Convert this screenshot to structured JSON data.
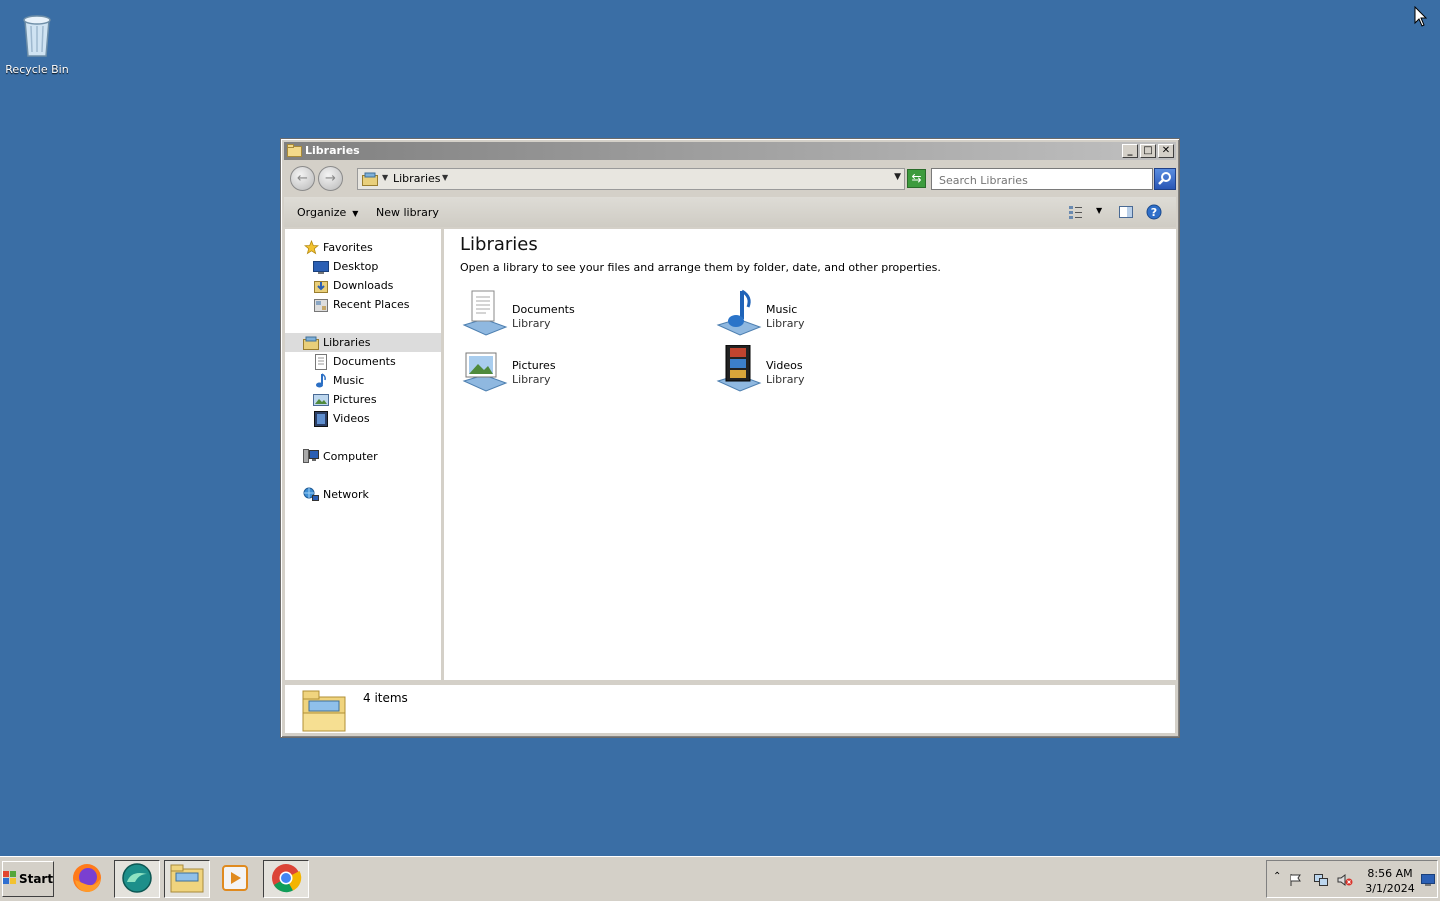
{
  "desktop": {
    "icons": [
      {
        "label": "Recycle Bin",
        "icon": "recycle-bin-icon"
      }
    ]
  },
  "window": {
    "title": "Libraries",
    "controls": {
      "minimize": "minimize-icon",
      "maximize": "maximize-icon",
      "close": "close-icon"
    },
    "address": {
      "crumb": "Libraries"
    },
    "search": {
      "placeholder": "Search Libraries"
    },
    "commands": {
      "organize": "Organize",
      "new_library": "New library"
    },
    "nav": {
      "favorites": "Favorites",
      "desktop": "Desktop",
      "downloads": "Downloads",
      "recent": "Recent Places",
      "libraries": "Libraries",
      "documents": "Documents",
      "music": "Music",
      "pictures": "Pictures",
      "videos": "Videos",
      "computer": "Computer",
      "network": "Network"
    },
    "content": {
      "heading": "Libraries",
      "description": "Open a library to see your files and arrange them by folder, date, and other properties.",
      "libraries": [
        {
          "name": "Documents",
          "type": "Library"
        },
        {
          "name": "Music",
          "type": "Library"
        },
        {
          "name": "Pictures",
          "type": "Library"
        },
        {
          "name": "Videos",
          "type": "Library"
        }
      ]
    },
    "status": {
      "items": "4 items"
    }
  },
  "taskbar": {
    "start": "Start",
    "apps": [
      "firefox-icon",
      "browser-icon",
      "file-explorer-icon",
      "media-player-icon",
      "chrome-icon"
    ],
    "clock": {
      "time": "8:56 AM",
      "date": "3/1/2024"
    }
  }
}
